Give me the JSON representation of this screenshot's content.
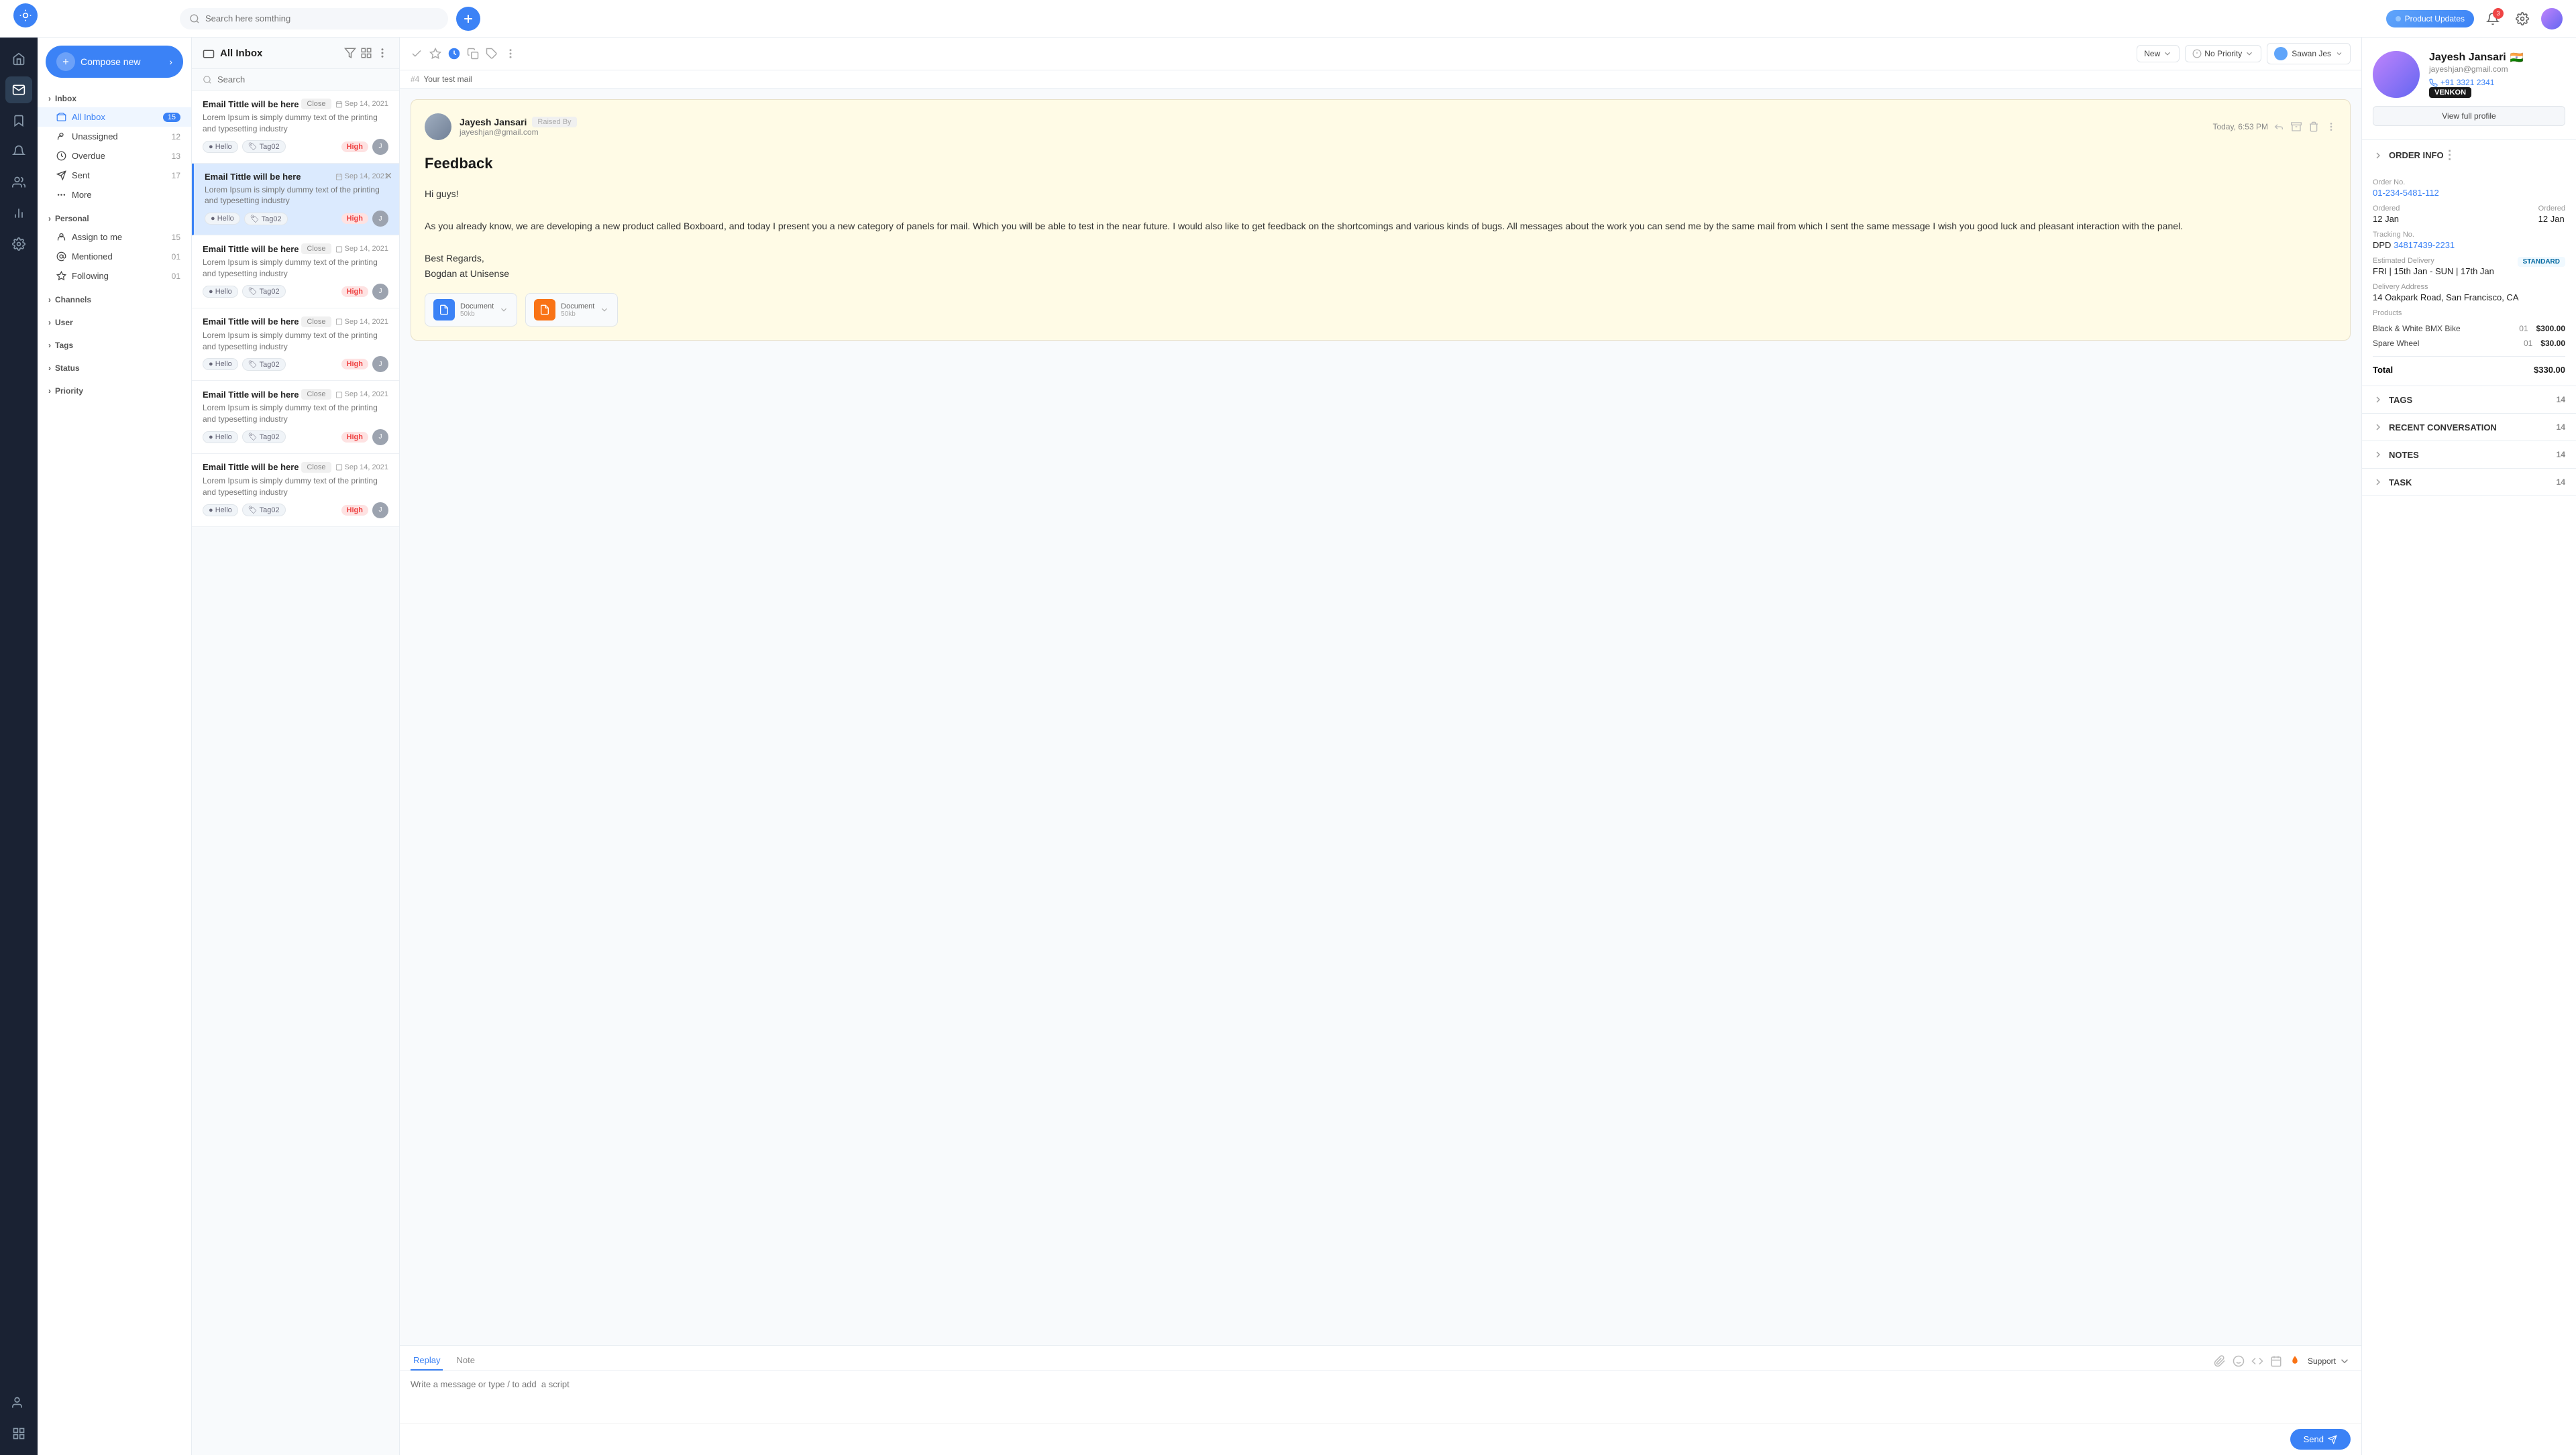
{
  "topbar": {
    "search_placeholder": "Search here somthing",
    "product_updates_label": "Product Updates",
    "plus_btn_label": "+"
  },
  "sidebar": {
    "compose_label": "Compose new",
    "inbox_label": "Inbox",
    "all_inbox_label": "All Inbox",
    "all_inbox_count": "15",
    "unassigned_label": "Unassigned",
    "unassigned_count": "12",
    "overdue_label": "Overdue",
    "overdue_count": "13",
    "sent_label": "Sent",
    "sent_count": "17",
    "more_label": "More",
    "personal_label": "Personal",
    "assign_to_me_label": "Assign to me",
    "assign_to_me_count": "15",
    "mentioned_label": "Mentioned",
    "mentioned_count": "01",
    "following_label": "Following",
    "following_count": "01",
    "channels_label": "Channels",
    "user_label": "User",
    "tags_label": "Tags",
    "status_label": "Status",
    "priority_label": "Priority"
  },
  "email_list": {
    "header": "All Inbox",
    "search_placeholder": "Search",
    "emails": [
      {
        "title": "Email Tittle will be here",
        "close_label": "Close",
        "date": "Sep 14, 2021",
        "body": "Lorem Ipsum is simply dummy text of the printing and typesetting industry",
        "tag1": "Hello",
        "tag2": "Tag02",
        "priority": "High",
        "selected": false
      },
      {
        "title": "Email Tittle will be here",
        "close_label": "Close",
        "date": "Sep 14, 2021",
        "body": "Lorem Ipsum is simply dummy text of the printing and typesetting industry",
        "tag1": "Hello",
        "tag2": "Tag02",
        "priority": "High",
        "selected": true
      },
      {
        "title": "Email Tittle will be here",
        "close_label": "Close",
        "date": "Sep 14, 2021",
        "body": "Lorem Ipsum is simply dummy text of the printing and typesetting industry",
        "tag1": "Hello",
        "tag2": "Tag02",
        "priority": "High",
        "selected": false
      },
      {
        "title": "Email Tittle will be here",
        "close_label": "Close",
        "date": "Sep 14, 2021",
        "body": "Lorem Ipsum is simply dummy text of the printing and typesetting industry",
        "tag1": "Hello",
        "tag2": "Tag02",
        "priority": "High",
        "selected": false
      },
      {
        "title": "Email Tittle will be here",
        "close_label": "Close",
        "date": "Sep 14, 2021",
        "body": "Lorem Ipsum is simply dummy text of the printing and typesetting industry",
        "tag1": "Hello",
        "tag2": "Tag02",
        "priority": "High",
        "selected": false
      },
      {
        "title": "Email Tittle will be here",
        "close_label": "Close",
        "date": "Sep 14, 2021",
        "body": "Lorem Ipsum is simply dummy text of the printing and typesetting industry",
        "tag1": "Hello",
        "tag2": "Tag02",
        "priority": "High",
        "selected": false
      }
    ]
  },
  "email_thread": {
    "ticket_num": "#4",
    "subject": "Your test mail",
    "status": {
      "new_label": "New",
      "no_priority_label": "No Priority",
      "assignee_name": "Sawan Jes"
    },
    "message": {
      "sender_name": "Jayesh Jansari",
      "raised_by_label": "Raised By",
      "sender_email": "jayeshjan@gmail.com",
      "time": "Today, 6:53 PM",
      "subject_heading": "Feedback",
      "greeting": "Hi guys!",
      "body1": "As you already know, we are developing a new product called Boxboard, and today I present you a new category of panels for mail. Which you will be able to test in the near future. I would also like to get feedback on the shortcomings and various kinds of bugs. All messages about the work you can send me by the same mail from which I sent the same message I wish you good luck and pleasant interaction with the panel.",
      "sign_off": "Best Regards,",
      "signature": "Bogdan at Unisense",
      "attachment1_size": "50kb",
      "attachment2_size": "50kb"
    },
    "reply_tab": "Replay",
    "note_tab": "Note",
    "reply_placeholder": "Write a message or type / to add  a script",
    "send_label": "Send",
    "support_label": "Support"
  },
  "right_panel": {
    "profile": {
      "name": "Jayesh Jansari",
      "email": "jayeshjan@gmail.com",
      "phone": "+91 3321 2341",
      "brand": "VENKON",
      "view_profile_label": "View full profile",
      "flag": "🇮🇳"
    },
    "order_info": {
      "section_label": "ORDER INFO",
      "order_no_label": "Order No.",
      "order_no": "01-234-5481-112",
      "ordered_label1": "Ordered",
      "ordered_date1": "12 Jan",
      "ordered_label2": "Ordered",
      "ordered_date2": "12 Jan",
      "tracking_label": "Tracking No.",
      "tracking_carrier": "DPD",
      "tracking_number": "34817439-2231",
      "delivery_label": "Estimated Delivery",
      "delivery_badge": "STANDARD",
      "delivery_dates": "FRI | 15th Jan - SUN | 17th Jan",
      "address_label": "Delivery Address",
      "address": "14 Oakpark Road, San Francisco, CA",
      "products_label": "Products",
      "product1_name": "Black & White BMX Bike",
      "product1_qty": "01",
      "product1_price": "$300.00",
      "product2_name": "Spare Wheel",
      "product2_qty": "01",
      "product2_price": "$30.00",
      "total_label": "Total",
      "total_price": "$330.00"
    },
    "tags_label": "TAGS",
    "tags_count": "14",
    "recent_conv_label": "RECENT CONVERSATION",
    "recent_conv_count": "14",
    "notes_label": "NOTES",
    "notes_count": "14",
    "task_label": "TASK",
    "task_count": "14"
  }
}
